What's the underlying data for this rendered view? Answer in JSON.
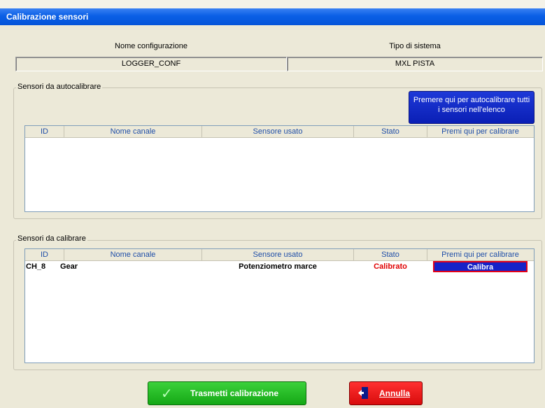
{
  "window": {
    "title": "Calibrazione sensori"
  },
  "config": {
    "nome_label": "Nome configurazione",
    "nome_value": "LOGGER_CONF",
    "tipo_label": "Tipo di sistema",
    "tipo_value": "MXL PISTA"
  },
  "auto_group": {
    "title": "Sensori da autocalibrare",
    "autocal_button_line1": "Premere qui per autocalibrare tutti",
    "autocal_button_line2": "i sensori nell'elenco",
    "columns": [
      "ID",
      "Nome canale",
      "Sensore usato",
      "Stato",
      "Premi qui per calibrare"
    ],
    "rows": []
  },
  "cal_group": {
    "title": "Sensori da calibrare",
    "columns": [
      "ID",
      "Nome canale",
      "Sensore usato",
      "Stato",
      "Premi qui per calibrare"
    ],
    "rows": [
      {
        "id": "CH_8",
        "nome": "Gear",
        "sensore": "Potenziometro marce",
        "stato": "Calibrato",
        "azione": "Calibra"
      }
    ]
  },
  "footer": {
    "trasmetti": "Trasmetti calibrazione",
    "annulla": "Annulla"
  },
  "colors": {
    "stato_calibrato": "#e00000",
    "title_bar": "#0a5fe6"
  }
}
